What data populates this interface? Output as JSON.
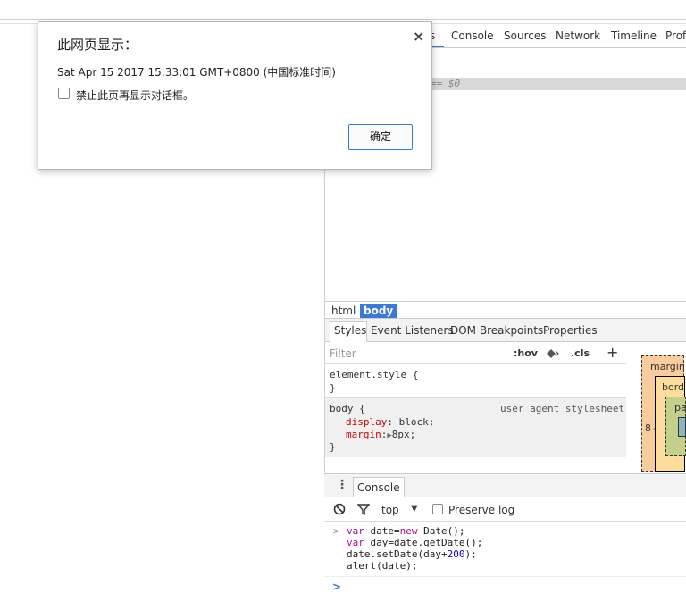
{
  "devtools": {
    "tabs": [
      "s",
      "Console",
      "Sources",
      "Network",
      "Timeline",
      "Profi"
    ],
    "selected_node_suffix": "== $0",
    "breadcrumbs": [
      "html",
      "body"
    ],
    "styles_tabs": [
      "Styles",
      "Event Listeners",
      "DOM Breakpoints",
      "Properties"
    ],
    "styles": {
      "filter_placeholder": "Filter",
      "hov_label": ":hov",
      "cls_label": ".cls",
      "add_label": "+",
      "element_style_open": "element.style {",
      "close_brace": "}",
      "body_selector": "body {",
      "body_source": "user agent stylesheet",
      "prop1_name": "display",
      "prop1_value": "block;",
      "prop2_name": "margin",
      "prop2_value": "8px;"
    },
    "box_model": {
      "margin_label": "margin",
      "border_label": "bord",
      "padding_label": "pa",
      "margin_left_value": "8",
      "dash": "–"
    },
    "drawer": {
      "tab_label": "Console",
      "context_value": "top",
      "preserve_log_label": "Preserve log"
    },
    "console_lines": [
      {
        "prompt": ">",
        "parts": [
          {
            "t": "var",
            "c": "kw"
          },
          {
            "t": " date=",
            "c": ""
          },
          {
            "t": "new",
            "c": "kw"
          },
          {
            "t": " Date();",
            "c": ""
          }
        ]
      },
      {
        "prompt": "",
        "parts": [
          {
            "t": "var",
            "c": "kw"
          },
          {
            "t": " day=date.getDate();",
            "c": ""
          }
        ]
      },
      {
        "prompt": "",
        "parts": [
          {
            "t": "date.setDate(day+",
            "c": ""
          },
          {
            "t": "200",
            "c": "num"
          },
          {
            "t": ");",
            "c": ""
          }
        ]
      },
      {
        "prompt": "",
        "parts": [
          {
            "t": "alert(date);",
            "c": ""
          }
        ]
      }
    ],
    "input_prompt": ">"
  },
  "dialog": {
    "title": "此网页显示：",
    "close": "×",
    "message": "Sat Apr 15 2017 15:33:01 GMT+0800 (中国标准时间)",
    "checkbox_label": "禁止此页再显示对话框。",
    "ok_label": "确定"
  },
  "colors": {
    "accent": "#3879d9",
    "margin_box": "#f9cc9d",
    "border_box": "#fddd9b",
    "padding_box": "#c3d08b",
    "content_box": "#8cb6c0"
  }
}
